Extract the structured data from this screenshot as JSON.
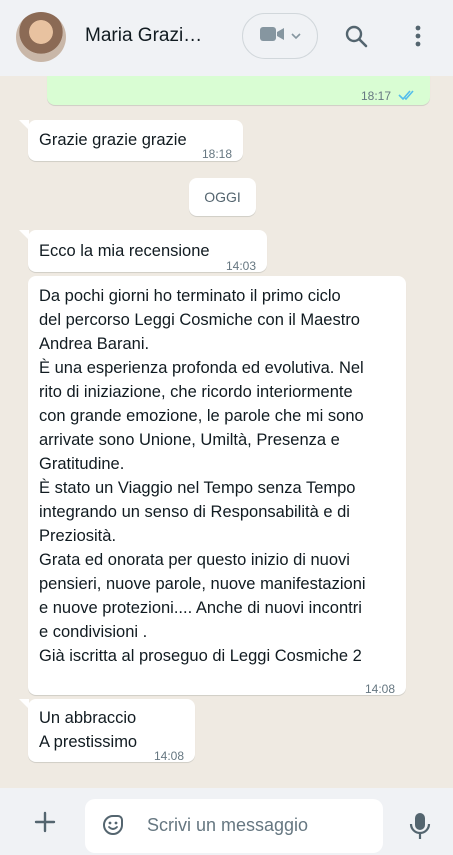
{
  "header": {
    "contact_name": "Maria Grazi…",
    "avatar_icon": "contact-avatar",
    "video_icon": "video-camera-icon",
    "dropdown_icon": "chevron-down-icon",
    "search_icon": "search-icon",
    "menu_icon": "vertical-dots-icon"
  },
  "messages": {
    "m0": {
      "time": "18:17",
      "status": "read"
    },
    "m1": {
      "text": "Grazie grazie grazie",
      "time": "18:18"
    },
    "date_divider": "OGGI",
    "m2": {
      "text": "Ecco la mia recensione",
      "time": "14:03"
    },
    "m3": {
      "text": "Da pochi giorni ho terminato il primo ciclo\ndel percorso Leggi Cosmiche con il Maestro\nAndrea Barani.\nÈ una esperienza profonda ed evolutiva. Nel\nrito di iniziazione, che ricordo interiormente\ncon grande emozione, le parole che mi sono\narrivate sono Unione, Umiltà, Presenza e\nGratitudine.\nÈ stato un Viaggio nel Tempo senza Tempo\nintegrando un senso di Responsabilità e di\nPreziosità.\nGrata ed onorata per questo inizio di nuovi\npensieri, nuove parole, nuove manifestazioni\ne nuove protezioni.... Anche di nuovi incontri\ne condivisioni .\nGià iscritta al proseguo di Leggi Cosmiche 2",
      "time": "14:08"
    },
    "m4": {
      "text": "Un abbraccio\nA prestissimo",
      "time": "14:08"
    }
  },
  "footer": {
    "placeholder": "Scrivi un messaggio",
    "plus_icon": "plus-icon",
    "sticker_icon": "sticker-icon",
    "mic_icon": "microphone-icon"
  },
  "colors": {
    "chat_bg": "#efeae2",
    "bar_bg": "#f0f2f5",
    "outgoing_bubble": "#d9fdd3",
    "incoming_bubble": "#ffffff",
    "read_ticks": "#53bdeb",
    "icon": "#54656f"
  }
}
